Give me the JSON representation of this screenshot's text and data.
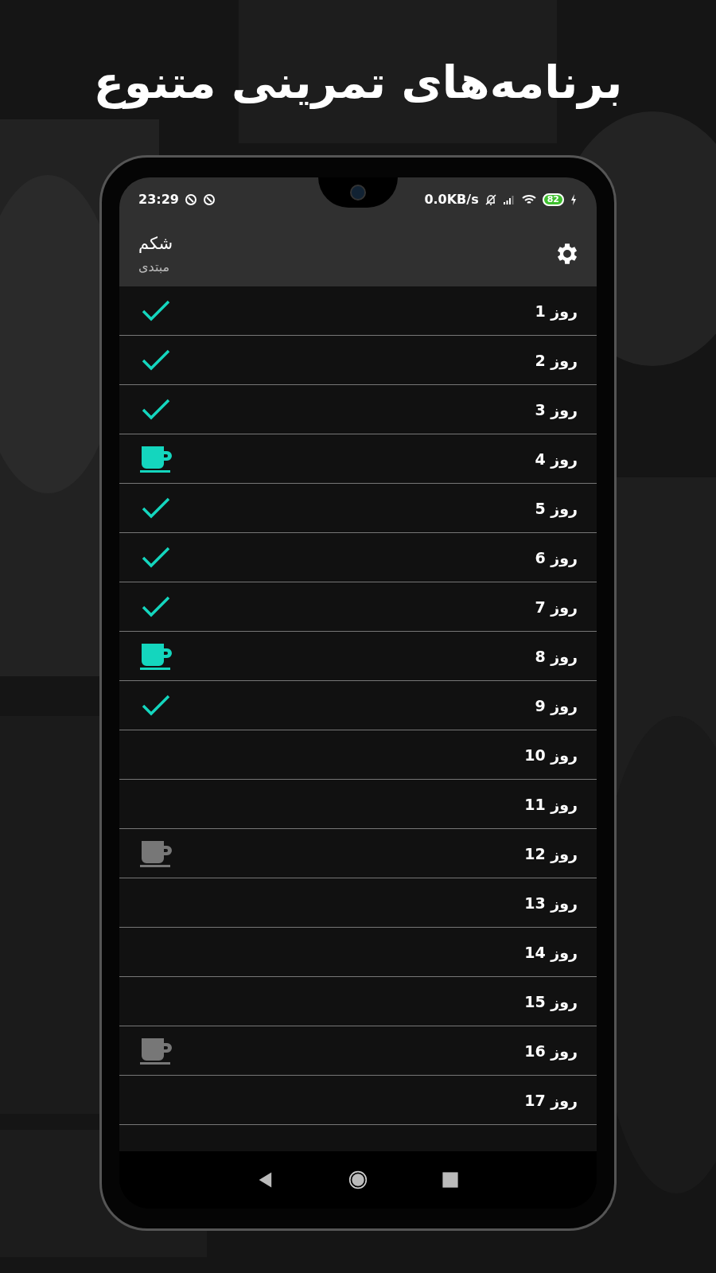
{
  "headline": "برنامه‌های تمرینی متنوع",
  "status_bar": {
    "time": "23:29",
    "net_speed": "0.0KB/s",
    "battery": "82"
  },
  "app_bar": {
    "title": "شکم",
    "subtitle": "مبتدی"
  },
  "days": [
    {
      "label": "روز 1",
      "kind": "workout",
      "completed": true
    },
    {
      "label": "روز 2",
      "kind": "workout",
      "completed": true
    },
    {
      "label": "روز 3",
      "kind": "workout",
      "completed": true
    },
    {
      "label": "روز 4",
      "kind": "rest",
      "completed": true
    },
    {
      "label": "روز 5",
      "kind": "workout",
      "completed": true
    },
    {
      "label": "روز 6",
      "kind": "workout",
      "completed": true
    },
    {
      "label": "روز 7",
      "kind": "workout",
      "completed": true
    },
    {
      "label": "روز 8",
      "kind": "rest",
      "completed": true
    },
    {
      "label": "روز 9",
      "kind": "workout",
      "completed": true
    },
    {
      "label": "روز 10",
      "kind": "workout",
      "completed": false
    },
    {
      "label": "روز 11",
      "kind": "workout",
      "completed": false
    },
    {
      "label": "روز 12",
      "kind": "rest",
      "completed": false
    },
    {
      "label": "روز 13",
      "kind": "workout",
      "completed": false
    },
    {
      "label": "روز 14",
      "kind": "workout",
      "completed": false
    },
    {
      "label": "روز 15",
      "kind": "workout",
      "completed": false
    },
    {
      "label": "روز 16",
      "kind": "rest",
      "completed": false
    },
    {
      "label": "روز 17",
      "kind": "workout",
      "completed": false
    }
  ]
}
